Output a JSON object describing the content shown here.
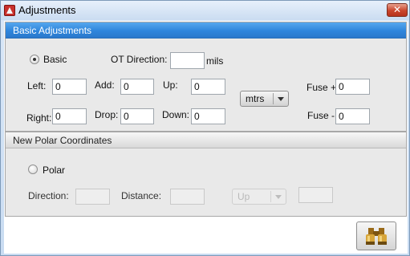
{
  "window": {
    "title": "Adjustments",
    "close_glyph": "✕",
    "app_icon": "app-icon"
  },
  "basic_panel": {
    "header": "Basic Adjustments",
    "radio_label": "Basic",
    "radio_checked": true,
    "ot_direction": {
      "label": "OT Direction:",
      "value": "",
      "unit": "mils"
    },
    "left": {
      "label": "Left:",
      "value": "0"
    },
    "right": {
      "label": "Right:",
      "value": "0"
    },
    "add": {
      "label": "Add:",
      "value": "0"
    },
    "drop": {
      "label": "Drop:",
      "value": "0"
    },
    "up": {
      "label": "Up:",
      "value": "0"
    },
    "down": {
      "label": "Down:",
      "value": "0"
    },
    "units": {
      "selected": "mtrs"
    },
    "fuse_plus": {
      "label": "Fuse +",
      "value": "0"
    },
    "fuse_minus": {
      "label": "Fuse -",
      "value": "0"
    }
  },
  "polar_panel": {
    "header": "New Polar Coordinates",
    "radio_label": "Polar",
    "radio_checked": false,
    "direction": {
      "label": "Direction:",
      "value": ""
    },
    "distance": {
      "label": "Distance:",
      "value": ""
    },
    "vertical": {
      "selected": "Up"
    },
    "extra_value": ""
  },
  "footer": {
    "find_button_icon": "binoculars-icon"
  },
  "colors": {
    "header_blue": "#2f86dc",
    "close_red": "#c9452c",
    "binocular_gold": "#c8962e"
  }
}
